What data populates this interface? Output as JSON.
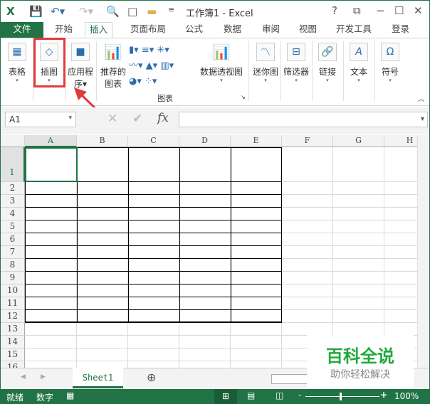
{
  "title": "工作簿1 - Excel",
  "window_controls": {
    "help": "?",
    "restore": "⧉",
    "minimize": "−",
    "maximize": "☐",
    "close": "✕"
  },
  "tabs": [
    "文件",
    "开始",
    "插入",
    "页面布局",
    "公式",
    "数据",
    "审阅",
    "视图",
    "开发工具",
    "登录"
  ],
  "ribbon": {
    "table": "表格",
    "illustrations": "插图",
    "apps": "应用程",
    "apps2": "序",
    "recommended": "推荐的",
    "recommended2": "图表",
    "pivotchart": "数据透视图",
    "sparkline": "迷你图",
    "filter": "筛选器",
    "link": "链接",
    "text": "文本",
    "symbol": "符号",
    "charts_group": "图表"
  },
  "namebox": "A1",
  "fx": "fx",
  "columns": [
    "A",
    "B",
    "C",
    "D",
    "E",
    "F",
    "G",
    "H"
  ],
  "rows": [
    "1",
    "2",
    "3",
    "4",
    "5",
    "6",
    "7",
    "8",
    "9",
    "10",
    "11",
    "12",
    "13",
    "14",
    "15",
    "16"
  ],
  "sheet_tab": "Sheet1",
  "status": {
    "ready": "就绪",
    "num": "数字",
    "zoom": "100%"
  },
  "watermark": {
    "title": "百科全说",
    "subtitle": "助你轻松解决"
  }
}
